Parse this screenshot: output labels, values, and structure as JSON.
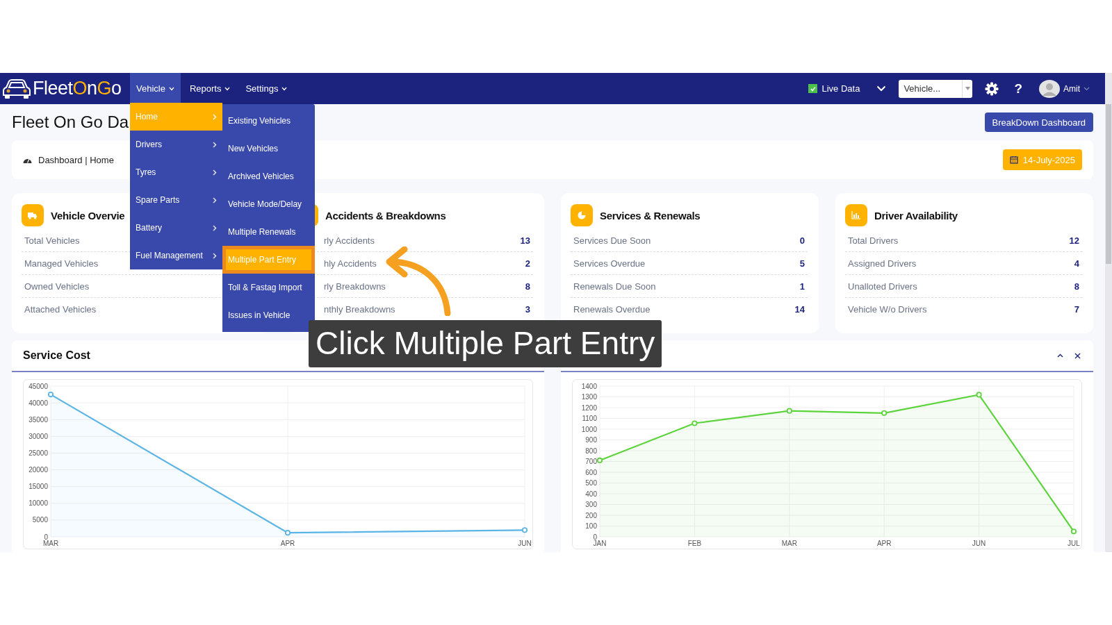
{
  "logo": {
    "parts": [
      {
        "text": "Fleet",
        "accent": false
      },
      {
        "text": "O",
        "accent": true
      },
      {
        "text": "n",
        "accent": false
      },
      {
        "text": "G",
        "accent": true
      },
      {
        "text": "o",
        "accent": false
      }
    ]
  },
  "nav": [
    {
      "label": "Vehicle",
      "selected": true
    },
    {
      "label": "Reports",
      "selected": false
    },
    {
      "label": "Settings",
      "selected": false
    }
  ],
  "live_data": {
    "label": "Live Data",
    "checked": true
  },
  "vehicle_select": {
    "value": "Vehicle..."
  },
  "help": "?",
  "user": {
    "name": "Amit"
  },
  "page_title": "Fleet On Go Da",
  "breakdown_button": "BreakDown Dashboard",
  "breadcrumb": "Dashboard | Home",
  "date": "14-July-2025",
  "cards": [
    {
      "title": "Vehicle Overvie",
      "kind": "truck",
      "rows": [
        {
          "label": "Total Vehicles"
        },
        {
          "label": "Managed Vehicles"
        },
        {
          "label": "Owned Vehicles"
        },
        {
          "label": "Attached Vehicles"
        }
      ]
    },
    {
      "title": "Accidents & Breakdowns",
      "kind": "alert",
      "rows": [
        {
          "label": "rly Accidents",
          "value": "13"
        },
        {
          "label": "hly Accidents",
          "value": "2"
        },
        {
          "label": "rly Breakdowns",
          "value": "8"
        },
        {
          "label": "nthly Breakdowns",
          "value": "3"
        }
      ]
    },
    {
      "title": "Services & Renewals",
      "kind": "pie",
      "rows": [
        {
          "label": "Services Due Soon",
          "value": "0"
        },
        {
          "label": "Services Overdue",
          "value": "5"
        },
        {
          "label": "Renewals Due Soon",
          "value": "1"
        },
        {
          "label": "Renewals Overdue",
          "value": "14"
        }
      ]
    },
    {
      "title": "Driver Availability",
      "kind": "bars",
      "rows": [
        {
          "label": "Total Drivers",
          "value": "12"
        },
        {
          "label": "Assigned Drivers",
          "value": "4"
        },
        {
          "label": "Unalloted Drivers",
          "value": "8"
        },
        {
          "label": "Vehicle W/o Drivers",
          "value": "7"
        }
      ]
    }
  ],
  "charts": [
    {
      "title": "Service Cost",
      "chart_data": {
        "type": "area",
        "grid": true,
        "categories": [
          "MAR",
          "APR",
          "JUN"
        ],
        "series": [
          {
            "color": "#5ab4e6",
            "marker": "o",
            "values": [
              42500,
              1200,
              2000
            ]
          }
        ],
        "ylim": [
          0,
          45000
        ],
        "yticks": [
          0,
          5000,
          10000,
          15000,
          20000,
          25000,
          30000,
          35000,
          40000,
          45000
        ]
      }
    },
    {
      "collapsible": true,
      "closable": true,
      "chart_data": {
        "type": "area",
        "grid": true,
        "categories": [
          "JAN",
          "FEB",
          "MAR",
          "APR",
          "JUN",
          "JUL"
        ],
        "series": [
          {
            "color": "#5cd43c",
            "marker": "o",
            "values": [
              710,
              1055,
              1170,
              1150,
              1320,
              50
            ]
          }
        ],
        "ylim": [
          0,
          1400
        ],
        "yticks": [
          0,
          100,
          200,
          300,
          400,
          500,
          600,
          700,
          800,
          900,
          1000,
          1100,
          1200,
          1300,
          1400
        ]
      }
    }
  ],
  "menu": {
    "items": [
      {
        "label": "Home",
        "selected": true
      },
      {
        "label": "Drivers",
        "selected": false
      },
      {
        "label": "Tyres",
        "selected": false
      },
      {
        "label": "Spare Parts",
        "selected": false
      },
      {
        "label": "Battery",
        "selected": false
      },
      {
        "label": "Fuel Management",
        "selected": false
      }
    ],
    "submenu": [
      {
        "label": "Existing Vehicles",
        "selected": false
      },
      {
        "label": "New Vehicles",
        "selected": false
      },
      {
        "label": "Archived Vehicles",
        "selected": false
      },
      {
        "label": "Vehicle Mode/Delay",
        "selected": false
      },
      {
        "label": "Multiple Renewals",
        "selected": false
      },
      {
        "label": "Multiple Part Entry",
        "selected": true
      },
      {
        "label": "Toll & Fastag Import",
        "selected": false
      },
      {
        "label": "Issues in Vehicle",
        "selected": false
      }
    ]
  },
  "callout": {
    "text": "Click Multiple Part Entry"
  }
}
